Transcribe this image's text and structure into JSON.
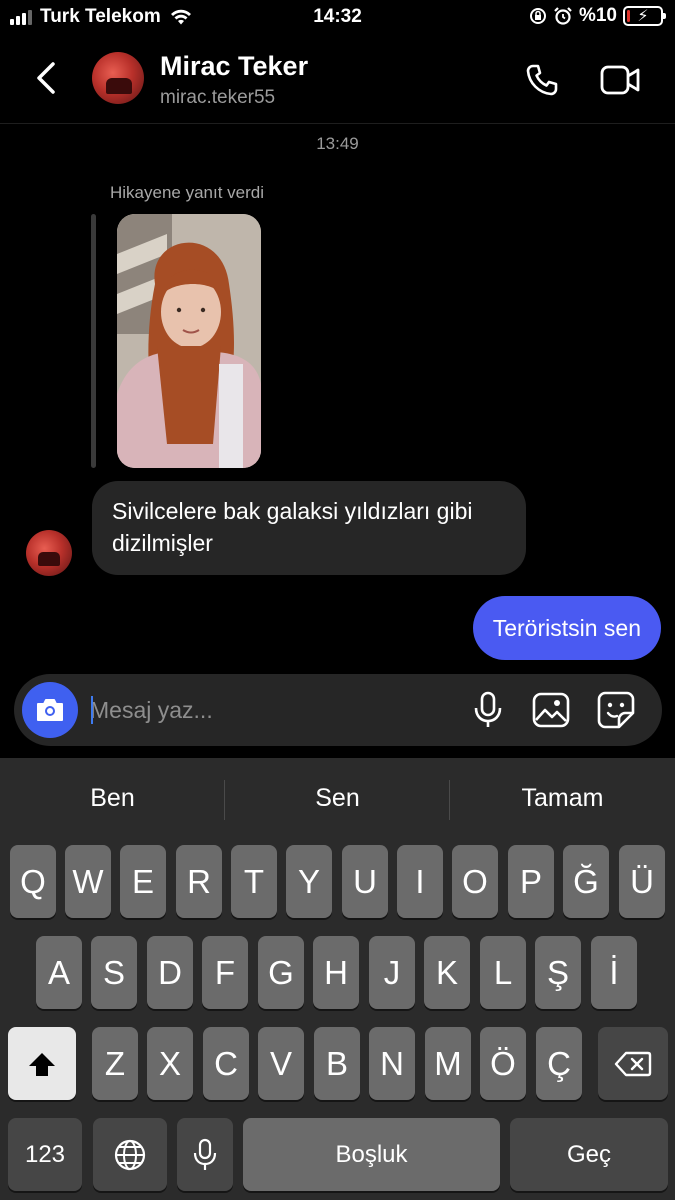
{
  "status_bar": {
    "carrier": "Turk Telekom",
    "time": "14:32",
    "battery_text": "%10",
    "battery_level": 0.1,
    "icons": [
      "signal-icon",
      "wifi-icon",
      "orientation-lock-icon",
      "alarm-icon",
      "battery-icon",
      "charging-bolt-icon"
    ]
  },
  "header": {
    "name": "Mirac Teker",
    "username": "mirac.teker55",
    "icons": [
      "back-chevron-icon",
      "phone-icon",
      "video-camera-icon"
    ]
  },
  "chat": {
    "timestamp": "13:49",
    "story_reply_label": "Hikayene yanıt verdi",
    "incoming_message": "Sivilcelere bak galaksi yıldızları gibi dizilmişler",
    "outgoing_message": "Teröristsin sen"
  },
  "composer": {
    "placeholder": "Mesaj yaz...",
    "icons": [
      "camera-icon",
      "microphone-icon",
      "gallery-icon",
      "sticker-icon"
    ]
  },
  "keyboard": {
    "suggestions": [
      "Ben",
      "Sen",
      "Tamam"
    ],
    "row1": [
      "Q",
      "W",
      "E",
      "R",
      "T",
      "Y",
      "U",
      "I",
      "O",
      "P",
      "Ğ",
      "Ü"
    ],
    "row2": [
      "A",
      "S",
      "D",
      "F",
      "G",
      "H",
      "J",
      "K",
      "L",
      "Ş",
      "İ"
    ],
    "row3": [
      "Z",
      "X",
      "C",
      "V",
      "B",
      "N",
      "M",
      "Ö",
      "Ç"
    ],
    "numbers_key": "123",
    "space_key": "Boşluk",
    "return_key": "Geç",
    "icons": [
      "shift-icon",
      "backspace-icon",
      "globe-icon",
      "dictation-mic-icon"
    ]
  },
  "colors": {
    "background": "#000000",
    "bubble_incoming": "#262626",
    "bubble_outgoing": "#4a5af2",
    "camera_button": "#3f60f0",
    "battery_low": "#e0342c",
    "keyboard_bg": "#2b2b2b",
    "key": "#6b6b6b",
    "key_dark": "#464646"
  }
}
